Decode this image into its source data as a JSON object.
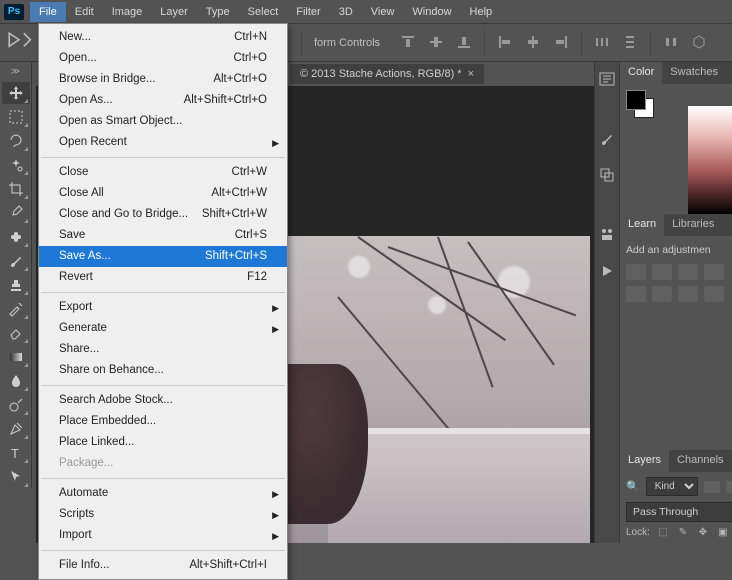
{
  "menubar": {
    "items": [
      "File",
      "Edit",
      "Image",
      "Layer",
      "Type",
      "Select",
      "Filter",
      "3D",
      "View",
      "Window",
      "Help"
    ],
    "active": 0
  },
  "options_bar": {
    "show_transform_label": "form Controls"
  },
  "doc_tab": {
    "label": "© 2013 Stache Actions, RGB/8) *"
  },
  "dropdown": {
    "groups": [
      [
        {
          "label": "New...",
          "shortcut": "Ctrl+N"
        },
        {
          "label": "Open...",
          "shortcut": "Ctrl+O"
        },
        {
          "label": "Browse in Bridge...",
          "shortcut": "Alt+Ctrl+O"
        },
        {
          "label": "Open As...",
          "shortcut": "Alt+Shift+Ctrl+O"
        },
        {
          "label": "Open as Smart Object...",
          "shortcut": ""
        },
        {
          "label": "Open Recent",
          "shortcut": "",
          "submenu": true
        }
      ],
      [
        {
          "label": "Close",
          "shortcut": "Ctrl+W"
        },
        {
          "label": "Close All",
          "shortcut": "Alt+Ctrl+W"
        },
        {
          "label": "Close and Go to Bridge...",
          "shortcut": "Shift+Ctrl+W"
        },
        {
          "label": "Save",
          "shortcut": "Ctrl+S"
        },
        {
          "label": "Save As...",
          "shortcut": "Shift+Ctrl+S",
          "highlight": true
        },
        {
          "label": "Revert",
          "shortcut": "F12"
        }
      ],
      [
        {
          "label": "Export",
          "shortcut": "",
          "submenu": true
        },
        {
          "label": "Generate",
          "shortcut": "",
          "submenu": true
        },
        {
          "label": "Share...",
          "shortcut": ""
        },
        {
          "label": "Share on Behance...",
          "shortcut": ""
        }
      ],
      [
        {
          "label": "Search Adobe Stock...",
          "shortcut": ""
        },
        {
          "label": "Place Embedded...",
          "shortcut": ""
        },
        {
          "label": "Place Linked...",
          "shortcut": ""
        },
        {
          "label": "Package...",
          "shortcut": "",
          "disabled": true
        }
      ],
      [
        {
          "label": "Automate",
          "shortcut": "",
          "submenu": true
        },
        {
          "label": "Scripts",
          "shortcut": "",
          "submenu": true
        },
        {
          "label": "Import",
          "shortcut": "",
          "submenu": true
        }
      ],
      [
        {
          "label": "File Info...",
          "shortcut": "Alt+Shift+Ctrl+I"
        }
      ]
    ]
  },
  "tools": [
    "move",
    "artboard",
    "marquee",
    "lasso",
    "crop",
    "eyedropper",
    "healing",
    "brush",
    "stamp",
    "history-brush",
    "eraser",
    "gradient",
    "blur",
    "dodge",
    "pen",
    "type",
    "path-select"
  ],
  "right": {
    "color_tab": "Color",
    "swatches_tab": "Swatches",
    "learn_tab": "Learn",
    "libraries_tab": "Libraries",
    "adjustments_label": "Add an adjustmen",
    "layers_tab": "Layers",
    "channels_tab": "Channels",
    "kind_label": "Kind",
    "blend_mode": "Pass Through",
    "lock_label": "Lock:"
  }
}
